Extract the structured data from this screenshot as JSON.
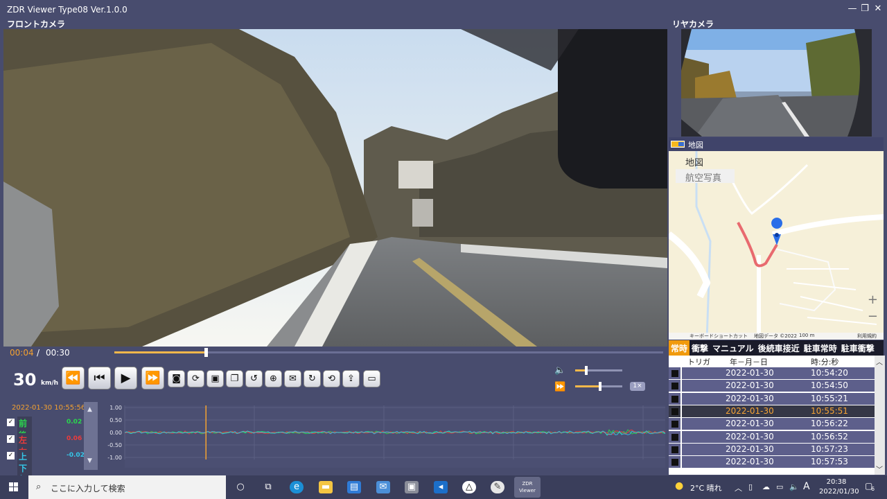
{
  "window": {
    "title": "ZDR Viewer Type08 Ver.1.0.0",
    "front_label": "フロントカメラ",
    "rear_label": "リヤカメラ",
    "minimize": "—",
    "maximize": "❐",
    "close": "✕"
  },
  "map": {
    "header": "地図",
    "type_map": "地図",
    "type_aerial": "航空写真",
    "zoom_in": "+",
    "zoom_out": "−",
    "footer": {
      "shortcuts": "キーボードショートカット",
      "copyright": "地図データ ©2022",
      "scale": "100 m",
      "terms": "利用規約"
    }
  },
  "tabs": [
    "常時",
    "衝撃",
    "マニュアル",
    "後続車接近",
    "駐車常時",
    "駐車衝撃"
  ],
  "active_tab": "常時",
  "table": {
    "headers": {
      "trigger": "トリガ",
      "date": "年－月－日",
      "time": "時:分:秒"
    },
    "rows": [
      {
        "date": "2022-01-30",
        "time": "10:54:20"
      },
      {
        "date": "2022-01-30",
        "time": "10:54:50"
      },
      {
        "date": "2022-01-30",
        "time": "10:55:21"
      },
      {
        "date": "2022-01-30",
        "time": "10:55:51",
        "selected": true
      },
      {
        "date": "2022-01-30",
        "time": "10:56:22"
      },
      {
        "date": "2022-01-30",
        "time": "10:56:52"
      },
      {
        "date": "2022-01-30",
        "time": "10:57:23"
      },
      {
        "date": "2022-01-30",
        "time": "10:57:53"
      }
    ]
  },
  "playback": {
    "current_time": "00:04",
    "separator": "/",
    "total_time": "00:30",
    "progress": 0.167,
    "speed": "30",
    "speed_unit": "km/h",
    "volume": 0.2,
    "rate_level": 0.5,
    "rate_label": "1×"
  },
  "controls": {
    "rewind": "⏪",
    "prev": "⏮",
    "play": "▶",
    "forward": "⏩"
  },
  "gsensor": {
    "timestamp": "2022-01-30 10:55:56",
    "axes": [
      {
        "name": "前後(X軸)",
        "value": "0.02",
        "color": "#29d94d"
      },
      {
        "name": "左右(Y軸)",
        "value": "0.06",
        "color": "#ee3b3b"
      },
      {
        "name": "上下(Z軸)",
        "value": "-0.02",
        "color": "#35c7e8"
      }
    ],
    "yticks": [
      "1.00",
      "0.50",
      "0.00",
      "-0.50",
      "-1.00"
    ]
  },
  "taskbar": {
    "search_placeholder": "ここに入力して検索",
    "weather": "2°C  晴れ",
    "ime": "A",
    "time": "20:38",
    "date": "2022/01/30",
    "notifications": "6"
  }
}
